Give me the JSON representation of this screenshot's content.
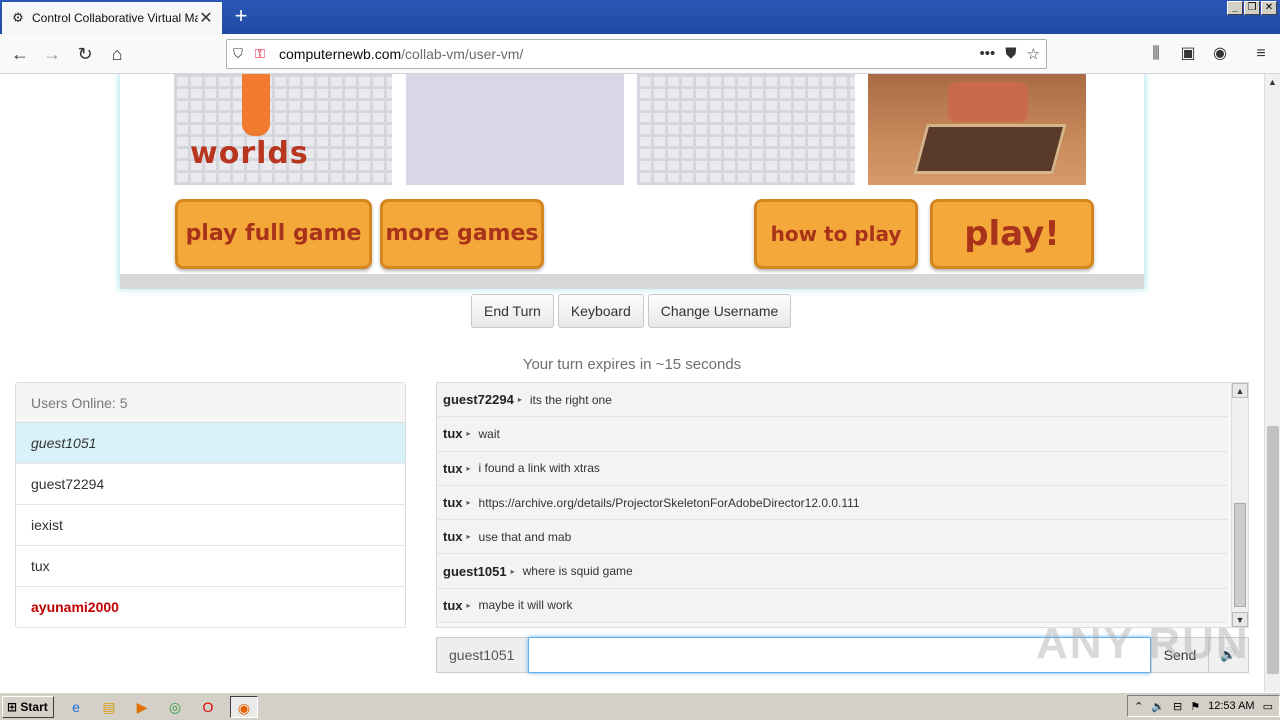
{
  "browser": {
    "tab_title": "Control Collaborative Virtual Machi",
    "url_domain": "computernewb.com",
    "url_path": "/collab-vm/user-vm/"
  },
  "game": {
    "worlds_text": "worlds",
    "buttons": [
      {
        "label": "play full game"
      },
      {
        "label": "more games"
      },
      {
        "label": "how to play"
      },
      {
        "label": "play!"
      }
    ]
  },
  "controls": {
    "end_turn": "End Turn",
    "keyboard": "Keyboard",
    "change_username": "Change Username",
    "turn_text": "Your turn expires in ~15 seconds"
  },
  "users": {
    "header": "Users Online: 5",
    "list": [
      "guest1051",
      "guest72294",
      "iexist",
      "tux",
      "ayunami2000"
    ]
  },
  "chat": {
    "messages": [
      {
        "user": "guest72294",
        "text": "its the right one"
      },
      {
        "user": "tux",
        "text": "wait"
      },
      {
        "user": "tux",
        "text": "i found a link with xtras"
      },
      {
        "user": "tux",
        "text": "https://archive.org/details/ProjectorSkeletonForAdobeDirector12.0.0.111"
      },
      {
        "user": "tux",
        "text": "use that and mab"
      },
      {
        "user": "guest1051",
        "text": "where is squid game"
      },
      {
        "user": "tux",
        "text": "maybe it will work"
      }
    ],
    "input_name": "guest1051",
    "input_value": "",
    "send_label": "Send"
  },
  "watermark": "ANY RUN",
  "taskbar": {
    "start_label": "Start",
    "clock": "12:53 AM"
  }
}
